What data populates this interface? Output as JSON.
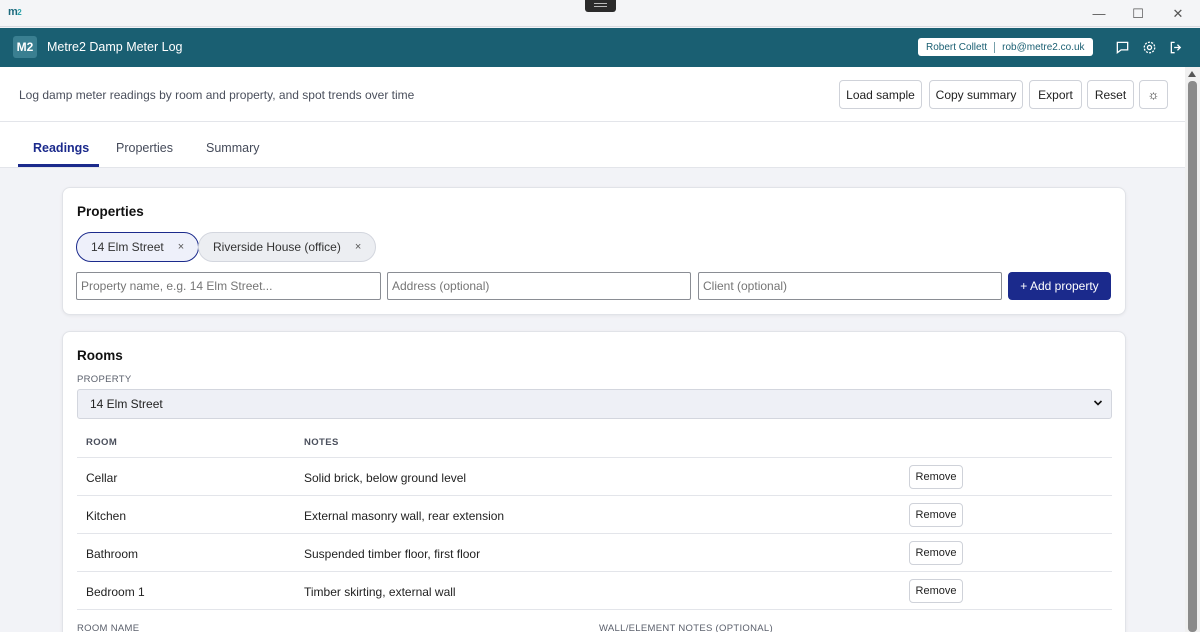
{
  "window": {
    "logo": "m",
    "logo_sub": "2",
    "minimize": "—",
    "maximize": "☐",
    "close": "✕"
  },
  "header": {
    "badge": "M2",
    "title": "Metre2 Damp Meter Log",
    "user_name": "Robert Collett",
    "user_email": "rob@metre2.co.uk",
    "accent_color": "#1a5f72"
  },
  "toolbar": {
    "description": "Log damp meter readings by room and property, and spot trends over time",
    "load_sample": "Load sample",
    "copy_summary": "Copy summary",
    "export": "Export",
    "reset": "Reset",
    "theme_toggle": "☼"
  },
  "tabs": [
    "Readings",
    "Properties",
    "Summary"
  ],
  "properties_card": {
    "heading": "Properties",
    "chips": [
      {
        "label": "14 Elm Street",
        "selected": true
      },
      {
        "label": "Riverside House (office)",
        "selected": false
      }
    ],
    "chip_remove": "×",
    "name_placeholder": "Property name, e.g. 14 Elm Street...",
    "address_placeholder": "Address (optional)",
    "client_placeholder": "Client (optional)",
    "add_button": "+ Add property"
  },
  "rooms_card": {
    "heading": "Rooms",
    "property_label": "PROPERTY",
    "selected_property": "14 Elm Street",
    "columns": [
      "ROOM",
      "NOTES"
    ],
    "remove_label": "Remove",
    "rows": [
      {
        "room": "Cellar",
        "notes": "Solid brick, below ground level"
      },
      {
        "room": "Kitchen",
        "notes": "External masonry wall, rear extension"
      },
      {
        "room": "Bathroom",
        "notes": "Suspended timber floor, first floor"
      },
      {
        "room": "Bedroom 1",
        "notes": "Timber skirting, external wall"
      }
    ],
    "room_name_label": "ROOM NAME",
    "wall_notes_label": "WALL/ELEMENT NOTES (OPTIONAL)"
  }
}
